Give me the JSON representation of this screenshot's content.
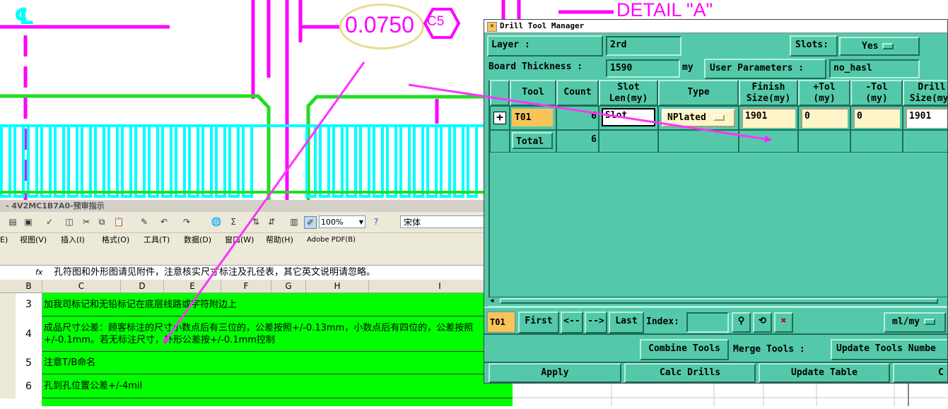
{
  "cad": {
    "detail_label": "DETAIL \"A\"",
    "dimension_value": "0.0750",
    "tag": "C5",
    "centerline_symbol": "℄"
  },
  "excel": {
    "window_title": "- 4V2MC1B7A0-预审指示",
    "zoom": "100%",
    "font_name": "宋体",
    "menu": [
      "E)",
      "视图(V)",
      "插入(I)",
      "格式(O)",
      "工具(T)",
      "数据(D)",
      "窗口(W)",
      "帮助(H)",
      "Adobe PDF(B)"
    ],
    "formula_label": "fx",
    "formula_text": "孔符图和外形图请见附件，注意核实尺寸标注及孔径表，其它英文说明请忽略。",
    "columns": [
      "B",
      "C",
      "D",
      "E",
      "F",
      "G",
      "H",
      "I"
    ],
    "rows": [
      {
        "num": "3",
        "text": "加我司标记和无铅标记在底层线路或字符附边上"
      },
      {
        "num": "4",
        "text": "成品尺寸公差：顾客标注的尺寸小数点后有三位的，公差按照+/-0.13mm，小数点后有四位的，公差按照+/-0.1mm。若无标注尺寸，外形公差按+/-0.1mm控制"
      },
      {
        "num": "5",
        "text": "注意T/B命名"
      },
      {
        "num": "6",
        "text": "孔到孔位置公差+/-4mil"
      }
    ]
  },
  "dtm": {
    "title": "Drill Tool Manager",
    "layer_label": "Layer          :",
    "layer_value": "2rd",
    "slots_label": "Slots:",
    "slots_value": "Yes",
    "board_thickness_label": "Board Thickness :",
    "board_thickness_value": "1590",
    "board_thickness_unit": "my",
    "user_params_label": "User Parameters :",
    "user_params_value": "no_hasl",
    "table": {
      "headers": [
        "Tool",
        "Count",
        "Slot Len(my)",
        "Type",
        "Finish Size(my)",
        "+Tol (my)",
        "-Tol (my)",
        "Drill Size(my)"
      ],
      "row": {
        "tool": "T01",
        "count": "6",
        "slot": "Slot",
        "type": "NPlated",
        "finish": "1901",
        "ptol": "0",
        "ntol": "0",
        "drill": "1901"
      },
      "total": {
        "label": "Total",
        "count": "6"
      }
    },
    "nav": {
      "current": "T01",
      "first": "First",
      "prev": "<--",
      "next": "-->",
      "last": "Last",
      "index_label": "Index:",
      "units": "ml/my"
    },
    "buttons": {
      "combine": "Combine Tools",
      "merge_label": "Merge Tools :",
      "update_tools": "Update Tools Numbe",
      "apply": "Apply",
      "calc": "Calc Drills",
      "update_table": "Update Table",
      "close": "C"
    }
  },
  "colors": {
    "teal": "#54c9a9",
    "cad_magenta": "#ff00ff",
    "cad_cyan": "#00ffff",
    "cad_green": "#22dd22",
    "excel_green": "#00ff00",
    "highlight_orange": "#f7c45a"
  }
}
